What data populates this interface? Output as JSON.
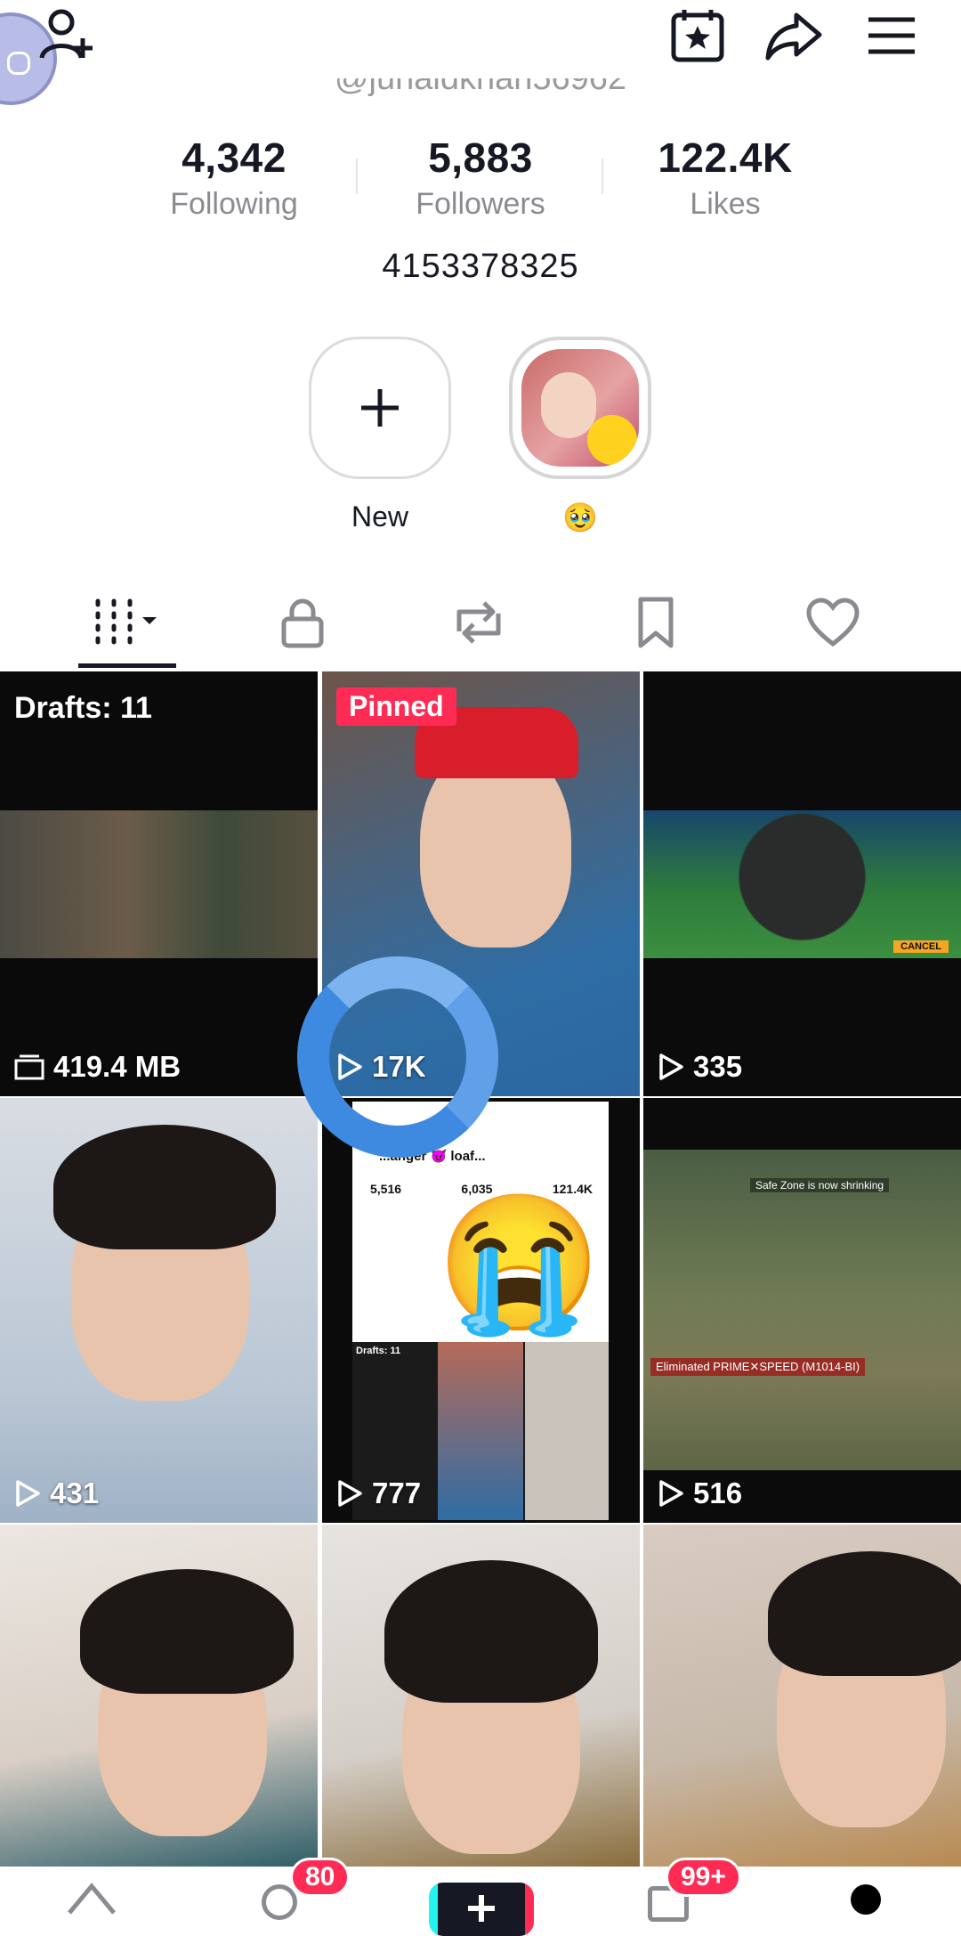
{
  "profile": {
    "handle": "@junaidkhan56962",
    "bio": "4153378325"
  },
  "stats": [
    {
      "value": "4,342",
      "label": "Following"
    },
    {
      "value": "5,883",
      "label": "Followers"
    },
    {
      "value": "122.4K",
      "label": "Likes"
    }
  ],
  "highlights": {
    "new_label": "New",
    "story_label": "🥹"
  },
  "tabs": [
    "videos",
    "private",
    "reposts",
    "favorites",
    "liked"
  ],
  "grid": {
    "drafts_label": "Drafts: 11",
    "drafts_size": "419.4 MB",
    "pinned_label": "Pinned",
    "items": [
      {
        "views": "17K"
      },
      {
        "views": "335"
      },
      {
        "views": "431"
      },
      {
        "views": "777"
      },
      {
        "views": "516"
      }
    ],
    "inner_screenshot": {
      "name": "...anger 😈 loaf...",
      "following": "5,516",
      "followers": "6,035",
      "likes": "121.4K",
      "drafts": "Drafts: 11"
    },
    "game_overlay_text": "Eliminated PRIME✕SPEED (M1014-BI)",
    "game_top_text": "Safe Zone is now shrinking",
    "game_cancel": "CANCEL"
  },
  "bottom_nav": {
    "friends_badge": "80",
    "inbox_badge": "99+"
  },
  "colors": {
    "accent": "#fe2c55",
    "loader": "#3d8ae0"
  }
}
